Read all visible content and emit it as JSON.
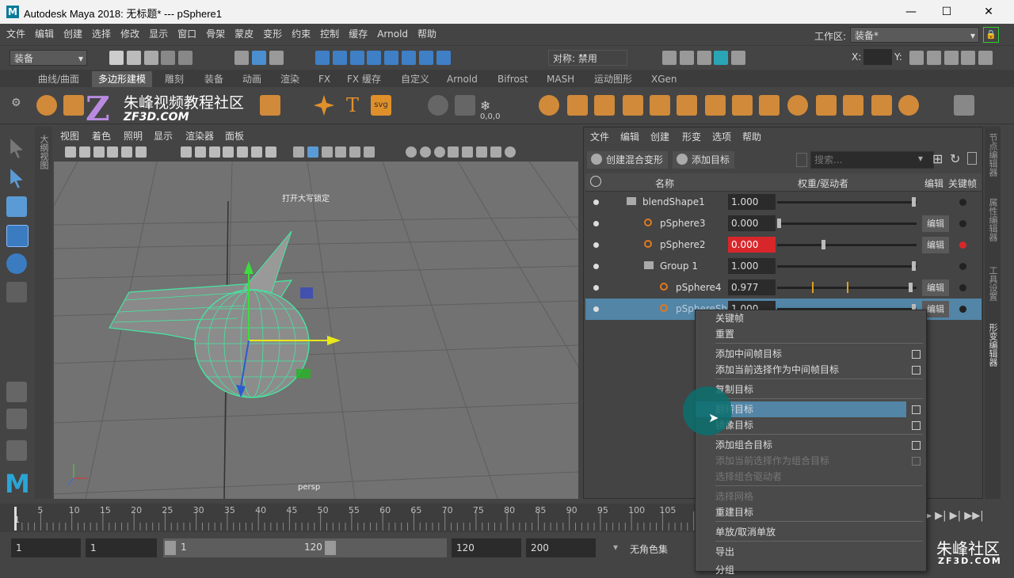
{
  "window": {
    "title": "Autodesk Maya 2018: 无标题*   ---   pSphere1",
    "logo_letter": "M",
    "minimize": "—",
    "maximize": "☐",
    "close": "✕"
  },
  "menubar": {
    "items": [
      "文件",
      "编辑",
      "创建",
      "选择",
      "修改",
      "显示",
      "窗口",
      "骨架",
      "蒙皮",
      "变形",
      "约束",
      "控制",
      "缓存",
      "Arnold",
      "帮助"
    ],
    "workspace_label": "工作区:",
    "workspace_value": "装备*"
  },
  "statusline": {
    "menuset": "装备",
    "symmetry": "对称: 禁用",
    "x_label": "X:",
    "y_label": "Y:"
  },
  "shelf_tabs": [
    "曲线/曲面",
    "多边形建模",
    "雕刻",
    "装备",
    "动画",
    "渲染",
    "FX",
    "FX 缓存",
    "自定义",
    "Arnold",
    "Bifrost",
    "MASH",
    "运动图形",
    "XGen"
  ],
  "shelf_active": "多边形建模",
  "shelf_text_icons": {
    "text": "T",
    "svg": "svg",
    "counter": "0,0,0"
  },
  "outliner_tab": "大纲视图",
  "viewport": {
    "menu": [
      "视图",
      "着色",
      "照明",
      "显示",
      "渲染器",
      "面板"
    ],
    "capslock_msg": "打开大写锁定",
    "camera": "persp"
  },
  "shape_editor": {
    "menu": [
      "文件",
      "编辑",
      "创建",
      "形变",
      "选项",
      "帮助"
    ],
    "btn_create_blend": "创建混合变形",
    "btn_add_target": "添加目标",
    "search_placeholder": "搜索...",
    "col_name": "名称",
    "col_weight": "权重/驱动者",
    "col_edit": "编辑",
    "col_key": "关键帧",
    "rows": [
      {
        "name": "blendShape1",
        "value": "1.000",
        "edit": "",
        "slider": 1.0
      },
      {
        "name": "pSphere3",
        "value": "0.000",
        "edit": "编辑",
        "slider": 0.0
      },
      {
        "name": "pSphere2",
        "value": "0.000",
        "edit": "编辑",
        "slider": 0.33,
        "keyed": true
      },
      {
        "name": "Group 1",
        "value": "1.000",
        "edit": "",
        "slider": 1.0
      },
      {
        "name": "pSphere4",
        "value": "0.977",
        "edit": "编辑",
        "slider": 0.977
      },
      {
        "name": "pSphereSh",
        "value": "1.000",
        "edit": "编辑",
        "slider": 1.0
      }
    ]
  },
  "side_tabs": [
    "节点编辑器",
    "属性编辑器",
    "工具设置",
    "形变编辑器"
  ],
  "context_menu": [
    {
      "label": "关键帧",
      "box": false,
      "disabled": false
    },
    {
      "label": "重置",
      "box": false,
      "disabled": false
    },
    {
      "label": "添加中间帧目标",
      "box": true,
      "disabled": false
    },
    {
      "label": "添加当前选择作为中间帧目标",
      "box": true,
      "disabled": false
    },
    {
      "label": "复制目标",
      "box": false,
      "disabled": false
    },
    {
      "label": "翻转目标",
      "box": true,
      "disabled": false,
      "highlight": true
    },
    {
      "label": "镜像目标",
      "box": true,
      "disabled": false
    },
    {
      "label": "添加组合目标",
      "box": true,
      "disabled": false
    },
    {
      "label": "添加当前选择作为组合目标",
      "box": true,
      "disabled": true
    },
    {
      "label": "选择组合驱动者",
      "box": false,
      "disabled": true
    },
    {
      "label": "选择网格",
      "box": false,
      "disabled": true
    },
    {
      "label": "重建目标",
      "box": false,
      "disabled": false
    },
    {
      "label": "单放/取消单放",
      "box": false,
      "disabled": false
    },
    {
      "label": "导出",
      "box": false,
      "disabled": false
    },
    {
      "label": "分组",
      "box": false,
      "disabled": false
    }
  ],
  "timeslider": {
    "ticks": [
      "5",
      "10",
      "15",
      "20",
      "25",
      "30",
      "35",
      "40",
      "45",
      "50",
      "55",
      "60",
      "65",
      "70",
      "75",
      "80",
      "85",
      "90",
      "95",
      "100",
      "105"
    ],
    "current_frame": "1"
  },
  "range": {
    "start": "1",
    "playback_start": "1",
    "slider_start": "1",
    "slider_end": "120",
    "playback_end": "120",
    "end": "200",
    "charset": "无角色集"
  },
  "watermark": {
    "site_cn": "朱峰视频教程社区",
    "site_url": "ZF3D.COM",
    "corner_cn": "朱峰社区",
    "corner_url": "ZF3D.COM"
  },
  "colors": {
    "accent": "#5285a6",
    "keyed_red": "#d9262b",
    "target_orange": "#e07a1e",
    "wire_green": "#44e6a0"
  }
}
